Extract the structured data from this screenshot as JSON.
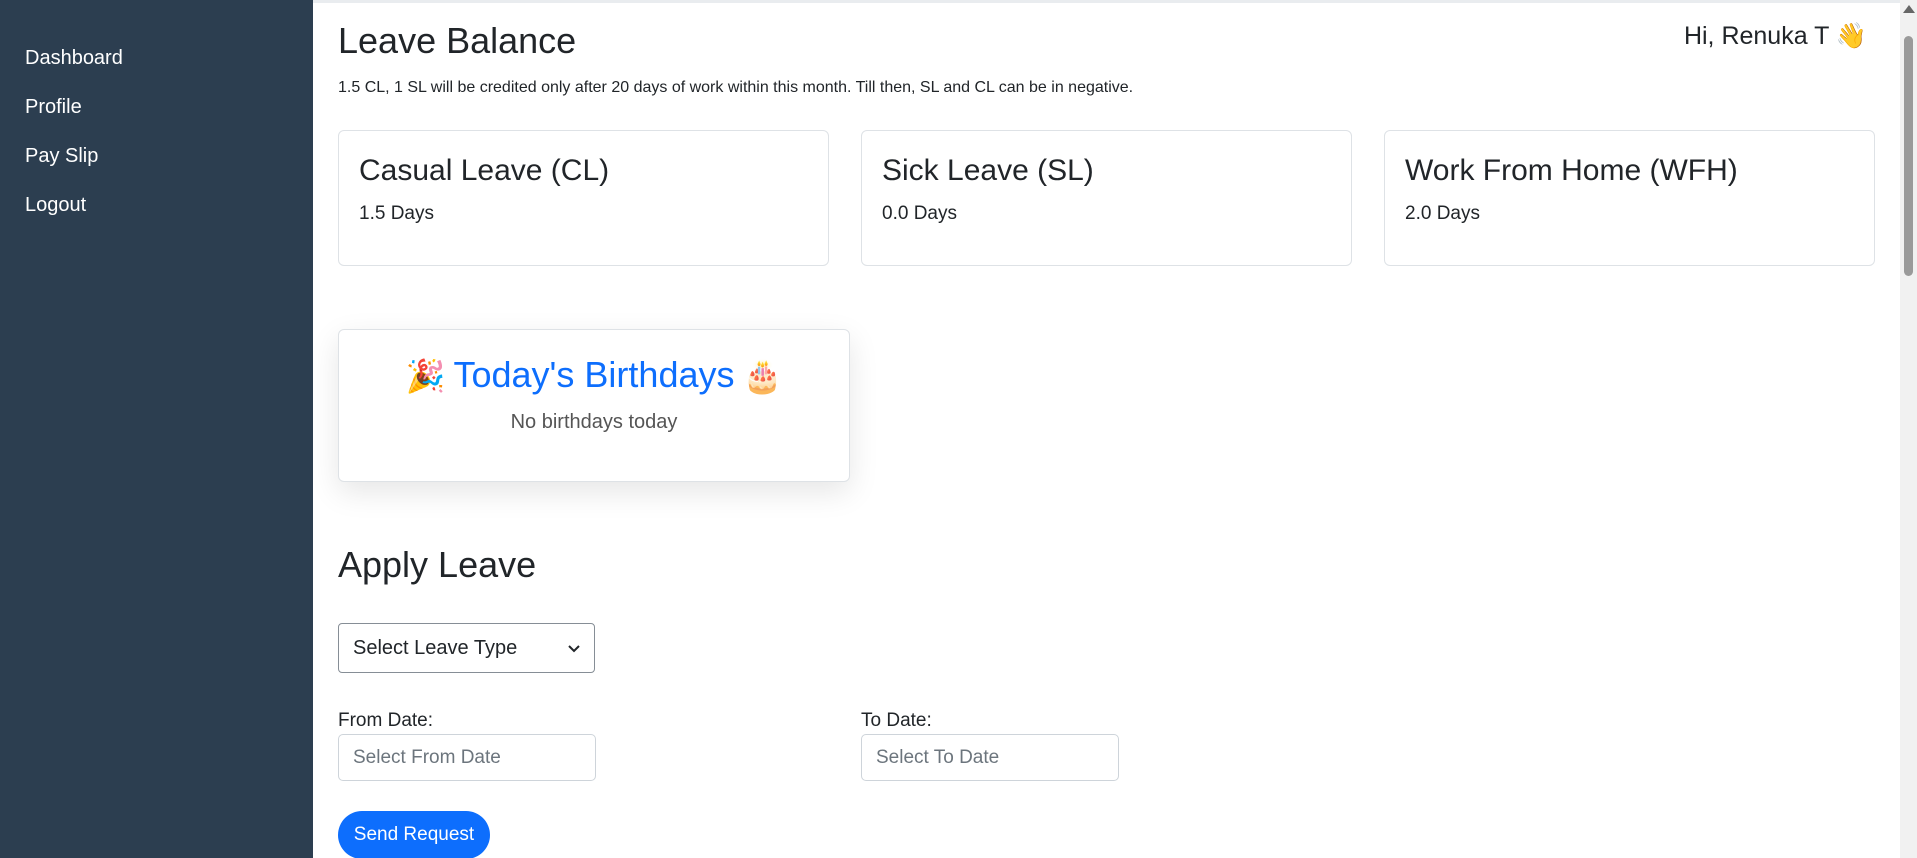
{
  "sidebar": {
    "items": [
      {
        "label": "Dashboard"
      },
      {
        "label": "Profile"
      },
      {
        "label": "Pay Slip"
      },
      {
        "label": "Logout"
      }
    ]
  },
  "header": {
    "title": "Leave Balance",
    "greeting": "Hi, Renuka T 👋"
  },
  "notice": "1.5 CL, 1 SL will be credited only after 20 days of work within this month. Till then, SL and CL can be in negative.",
  "balances": [
    {
      "title": "Casual Leave (CL)",
      "value": "1.5 Days"
    },
    {
      "title": "Sick Leave (SL)",
      "value": "0.0 Days"
    },
    {
      "title": "Work From Home (WFH)",
      "value": "2.0 Days"
    }
  ],
  "birthdays": {
    "emoji_left": "🎉",
    "title": "Today's Birthdays",
    "emoji_right": "🎂",
    "message": "No birthdays today"
  },
  "apply": {
    "title": "Apply Leave",
    "leave_type_selected": "Select Leave Type",
    "from_label": "From Date:",
    "from_placeholder": "Select From Date",
    "to_label": "To Date:",
    "to_placeholder": "Select To Date",
    "submit_label": "Send Request"
  },
  "colors": {
    "sidebar_bg": "#2c3e50",
    "accent": "#0d6efd"
  }
}
